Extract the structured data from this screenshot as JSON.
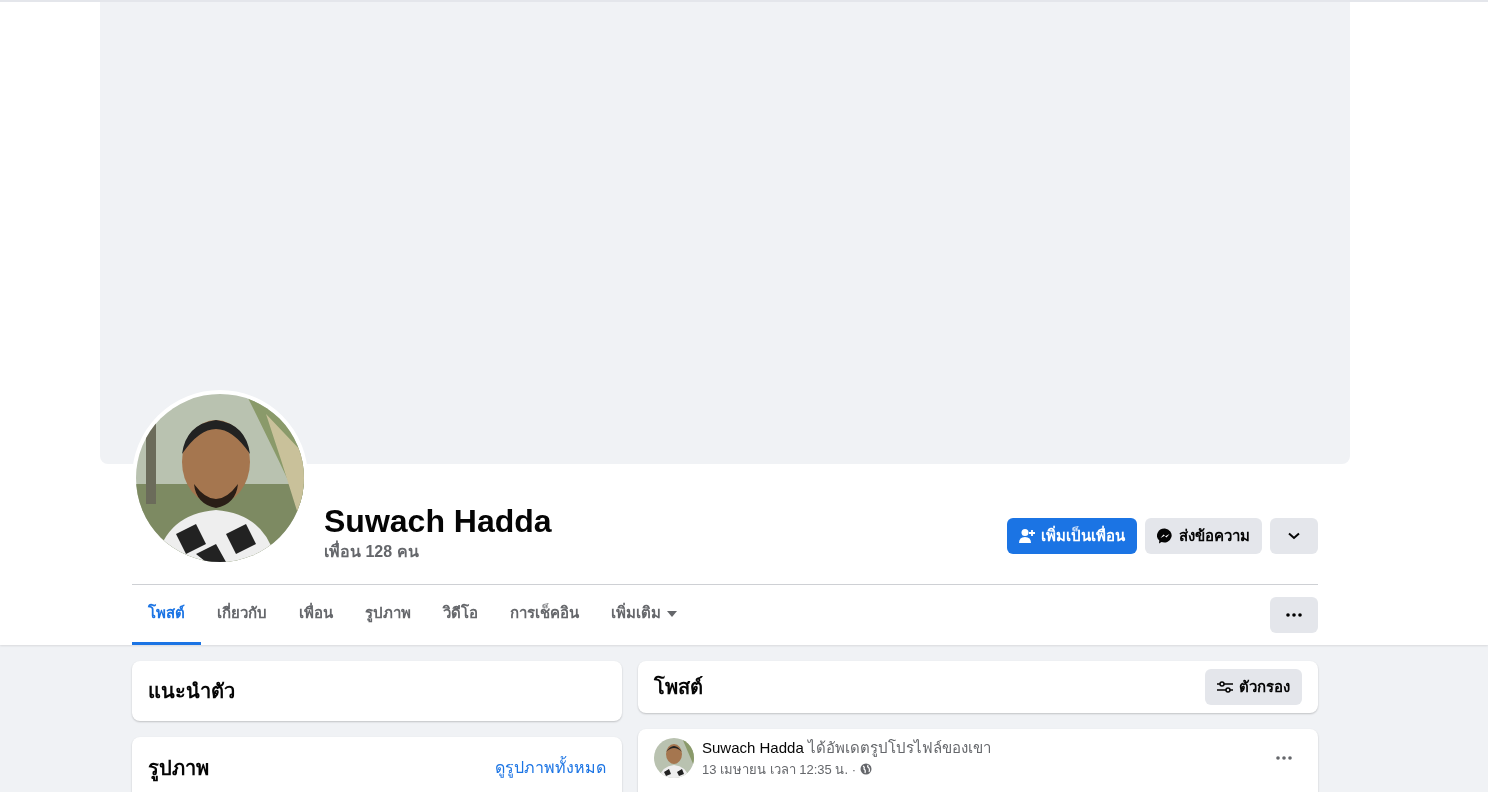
{
  "profile": {
    "name": "Suwach Hadda",
    "friends": "เพื่อน 128 คน"
  },
  "actions": [
    {
      "kind": "add-friend",
      "label": "เพิ่มเป็นเพื่อน"
    },
    {
      "kind": "message",
      "label": "ส่งข้อความ"
    },
    {
      "kind": "dropdown"
    }
  ],
  "tabs": [
    {
      "label": "โพสต์",
      "selected": true,
      "kind": "plain"
    },
    {
      "label": "เกี่ยวกับ",
      "selected": false,
      "kind": "plain"
    },
    {
      "label": "เพื่อน",
      "selected": false,
      "kind": "plain"
    },
    {
      "label": "รูปภาพ",
      "selected": false,
      "kind": "plain"
    },
    {
      "label": "วิดีโอ",
      "selected": false,
      "kind": "plain"
    },
    {
      "label": "การเช็คอิน",
      "selected": false,
      "kind": "plain"
    },
    {
      "label": "เพิ่มเติม",
      "selected": false,
      "kind": "dropdown"
    }
  ],
  "intro": {
    "title": "แนะนำตัว"
  },
  "photos": {
    "title": "รูปภาพ",
    "link": "ดูรูปภาพทั้งหมด"
  },
  "posts_header": {
    "title": "โพสต์",
    "filter": "ตัวกรอง"
  },
  "post": {
    "author": "Suwach Hadda",
    "action": "ได้อัพเดตรูปโปรไฟล์ของเขา",
    "time": "13 เมษายน เวลา 12:35 น. ·"
  }
}
